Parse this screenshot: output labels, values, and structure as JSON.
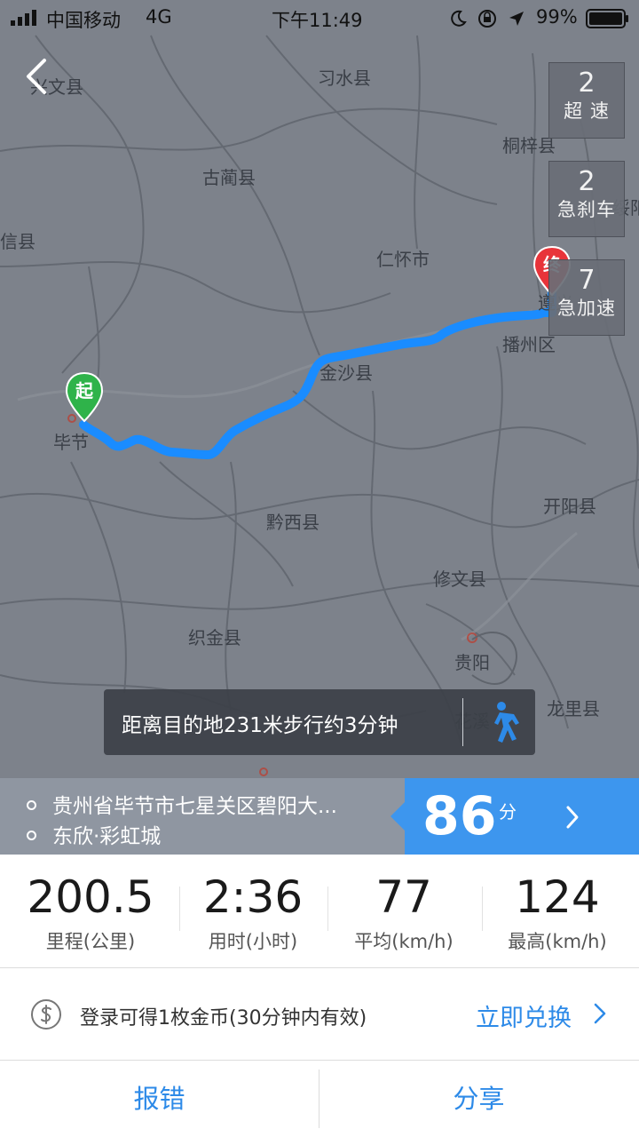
{
  "status_bar": {
    "carrier": "中国移动",
    "network": "4G",
    "time": "下午11:49",
    "battery": "99%"
  },
  "map": {
    "places": [
      "兴文县",
      "习水县",
      "桐梓县",
      "古蔺县",
      "绥阳",
      "信县",
      "仁怀市",
      "遵义",
      "播州区",
      "金沙县",
      "毕节",
      "黔西县",
      "开阳县",
      "修文县",
      "织金县",
      "贵阳",
      "花溪",
      "龙里县"
    ]
  },
  "events": [
    {
      "count": "2",
      "label": "超 速"
    },
    {
      "count": "2",
      "label": "急刹车"
    },
    {
      "count": "7",
      "label": "急加速"
    }
  ],
  "markers": {
    "start": "起",
    "end": "终"
  },
  "nav_tip": {
    "text": "距离目的地231米步行约3分钟"
  },
  "route": {
    "origin": "贵州省毕节市七星关区碧阳大...",
    "destination": "东欣·彩虹城",
    "score": "86",
    "score_unit": "分"
  },
  "stats": [
    {
      "value": "200.5",
      "label": "里程(公里)"
    },
    {
      "value": "2:36",
      "label": "用时(小时)"
    },
    {
      "value": "77",
      "label": "平均(km/h)"
    },
    {
      "value": "124",
      "label": "最高(km/h)"
    }
  ],
  "coin": {
    "text": "登录可得1枚金币(30分钟内有效)",
    "action": "立即兑换"
  },
  "buttons": {
    "report": "报错",
    "share": "分享"
  },
  "colors": {
    "accent": "#3d96ee",
    "link": "#2d8ae8",
    "route": "#1a8cff",
    "start": "#2fb34a",
    "end": "#e8343a"
  }
}
